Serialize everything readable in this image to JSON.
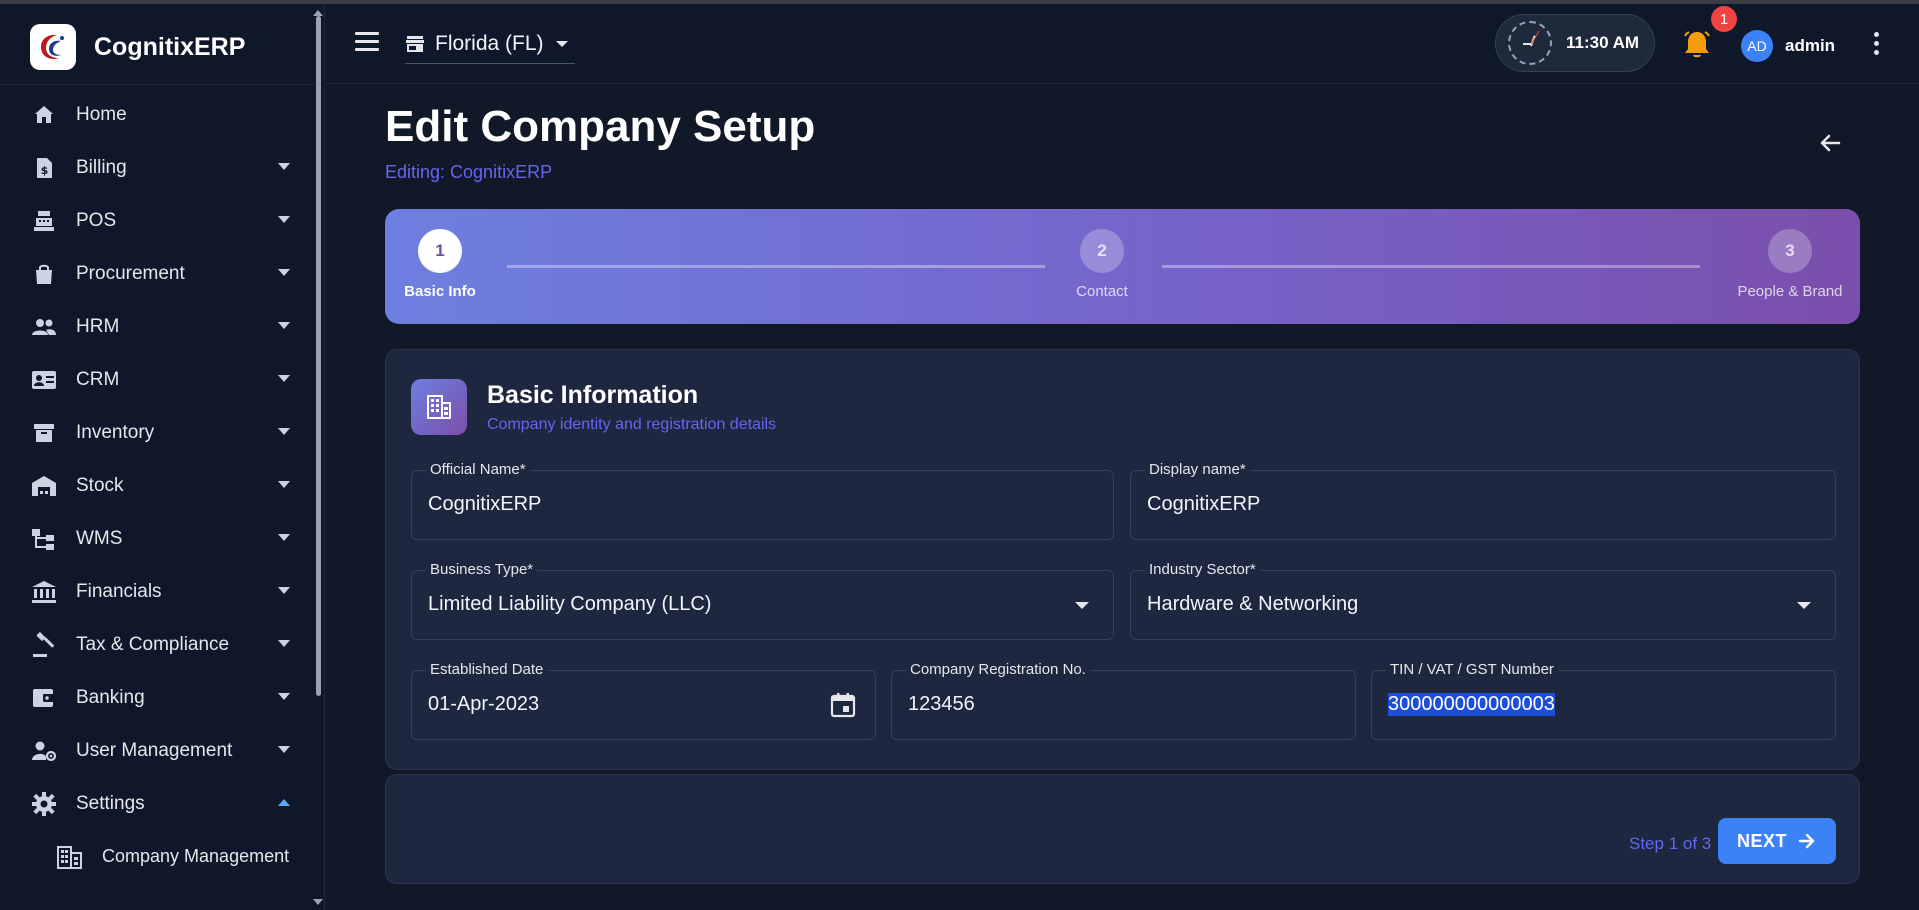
{
  "app": {
    "name": "CognitixERP"
  },
  "sidebar": {
    "items": [
      {
        "label": "Home",
        "icon": "home-icon"
      },
      {
        "label": "Billing",
        "icon": "billing-icon"
      },
      {
        "label": "POS",
        "icon": "pos-icon"
      },
      {
        "label": "Procurement",
        "icon": "shopping-bag-icon"
      },
      {
        "label": "HRM",
        "icon": "people-icon"
      },
      {
        "label": "CRM",
        "icon": "contact-card-icon"
      },
      {
        "label": "Inventory",
        "icon": "archive-icon"
      },
      {
        "label": "Stock",
        "icon": "warehouse-icon"
      },
      {
        "label": "WMS",
        "icon": "hierarchy-icon"
      },
      {
        "label": "Financials",
        "icon": "bank-icon"
      },
      {
        "label": "Tax & Compliance",
        "icon": "gavel-icon"
      },
      {
        "label": "Banking",
        "icon": "wallet-icon"
      },
      {
        "label": "User Management",
        "icon": "user-gear-icon"
      },
      {
        "label": "Settings",
        "icon": "gear-icon"
      }
    ],
    "sub_items": [
      {
        "label": "Company Management",
        "icon": "building-icon"
      }
    ]
  },
  "header": {
    "store": "Florida (FL)",
    "time": "11:30 AM",
    "notification_count": "1",
    "avatar_initials": "AD",
    "user_name": "admin"
  },
  "page": {
    "title": "Edit Company Setup",
    "subtitle": "Editing: CognitixERP"
  },
  "stepper": {
    "steps": [
      {
        "number": "1",
        "label": "Basic Info",
        "state": "active"
      },
      {
        "number": "2",
        "label": "Contact",
        "state": "inactive"
      },
      {
        "number": "3",
        "label": "People & Brand",
        "state": "inactive"
      }
    ]
  },
  "card": {
    "title": "Basic Information",
    "subtitle": "Company identity and registration details"
  },
  "form": {
    "official_name": {
      "label": "Official Name*",
      "value": "CognitixERP"
    },
    "display_name": {
      "label": "Display name*",
      "value": "CognitixERP"
    },
    "business_type": {
      "label": "Business Type*",
      "value": "Limited Liability Company (LLC)"
    },
    "industry_sector": {
      "label": "Industry Sector*",
      "value": "Hardware & Networking"
    },
    "established_date": {
      "label": "Established Date",
      "value": "01-Apr-2023"
    },
    "registration_no": {
      "label": "Company Registration No.",
      "value": "123456"
    },
    "tin": {
      "label": "TIN / VAT / GST Number",
      "value": "300000000000003"
    }
  },
  "footer": {
    "step_text": "Step 1 of 3",
    "next_label": "NEXT"
  },
  "colors": {
    "accent": "#3b82f6",
    "link": "#6366f1",
    "badge": "#ef4444",
    "bell": "#f59e0b",
    "gradient_start": "#6d7fe0",
    "gradient_end": "#7a4fab"
  }
}
